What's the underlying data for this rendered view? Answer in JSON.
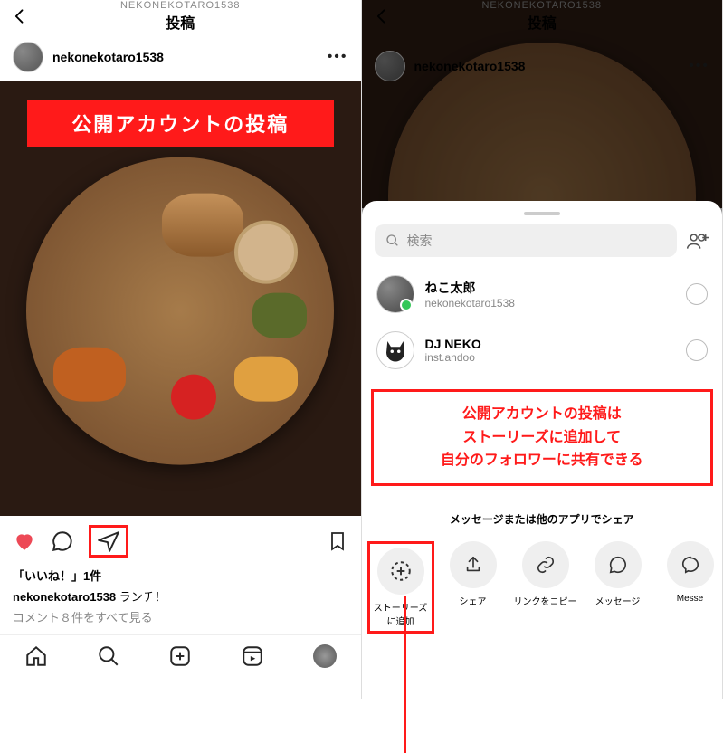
{
  "left": {
    "header": {
      "subtitle": "NEKONEKOTARO1538",
      "title": "投稿"
    },
    "post": {
      "username": "nekonekotaro1538",
      "overlay": "公開アカウントの投稿",
      "likes": "「いいね！」1件",
      "caption_user": "nekonekotaro1538",
      "caption_text": "ランチ！",
      "comments": "コメント８件をすべて見る"
    }
  },
  "right": {
    "header": {
      "subtitle": "NEKONEKOTARO1538",
      "title": "投稿"
    },
    "post": {
      "username": "nekonekotaro1538"
    },
    "sheet": {
      "search_placeholder": "検索",
      "contacts": [
        {
          "name": "ねこ太郎",
          "handle": "nekonekotaro1538"
        },
        {
          "name": "DJ NEKO",
          "handle": "inst.andoo"
        }
      ],
      "callout": "公開アカウントの投稿は\nストーリーズに追加して\n自分のフォロワーに共有できる",
      "share_header": "メッセージまたは他のアプリでシェア",
      "share_items": [
        {
          "label": "ストーリーズに追加"
        },
        {
          "label": "シェア"
        },
        {
          "label": "リンクをコピー"
        },
        {
          "label": "メッセージ"
        },
        {
          "label": "Messe"
        }
      ]
    }
  }
}
